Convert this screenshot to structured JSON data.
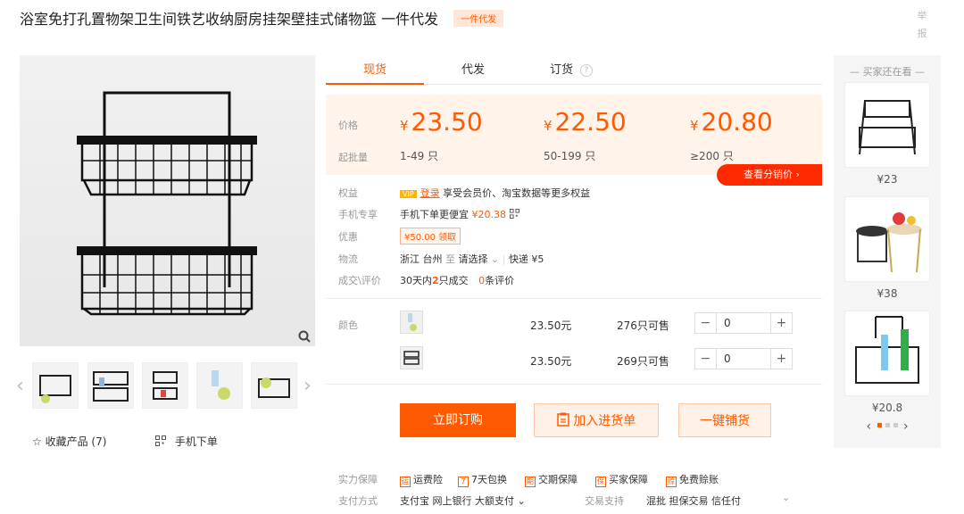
{
  "title": "浴室免打孔置物架卫生间铁艺收纳厨房挂架壁挂式储物篮 一件代发",
  "title_badge": "一件代发",
  "report": "举报",
  "tabs": [
    {
      "label": "现货"
    },
    {
      "label": "代发"
    },
    {
      "label": "订货"
    }
  ],
  "price_panel": {
    "price_label": "价格",
    "qty_label": "起批量",
    "currency": "¥",
    "tiers": [
      {
        "price": "23.50",
        "qty": "1-49 只"
      },
      {
        "price": "22.50",
        "qty": "50-199 只"
      },
      {
        "price": "20.80",
        "qty": "≥200 只"
      }
    ],
    "distrib_button": "查看分销价 ›"
  },
  "info": {
    "benefit_label": "权益",
    "vip_badge": "VIP",
    "login_link": "登录",
    "benefit_text": "享受会员价、淘宝数据等更多权益",
    "mobile_label": "手机专享",
    "mobile_text": "手机下单更便宜",
    "mobile_price": "¥20.38",
    "discount_label": "优惠",
    "coupon": "¥50.00 领取",
    "logistics_label": "物流",
    "origin": "浙江 台州",
    "to": "至",
    "dest": "请选择",
    "express": "快递 ¥5",
    "deals_label": "成交\\评价",
    "deals_prefix": "30天内",
    "deals_count": "2",
    "deals_suffix": "只成交",
    "review_count": "0",
    "review_suffix": "条评价"
  },
  "variants": {
    "label": "颜色",
    "items": [
      {
        "price": "23.50元",
        "stock": "276只可售",
        "qty": "0"
      },
      {
        "price": "23.50元",
        "stock": "269只可售",
        "qty": "0"
      }
    ]
  },
  "actions": {
    "buy": "立即订购",
    "add": "加入进货单",
    "distribute": "一键铺货"
  },
  "guarantee": {
    "label": "实力保障",
    "items": [
      "运费险",
      "7天包换",
      "交期保障",
      "买家保障",
      "免费赊账"
    ]
  },
  "payment": {
    "label": "支付方式",
    "methods": "支付宝  网上银行  大额支付 ⌄",
    "trade_label": "交易支持",
    "trade_items": "混批  担保交易  信任付"
  },
  "left": {
    "favorite": "☆  收藏产品 (7)",
    "mobile_order": "手机下单"
  },
  "side": {
    "header": "买家还在看",
    "items": [
      {
        "price": "¥23"
      },
      {
        "price": "¥38"
      },
      {
        "price": "¥20.8"
      }
    ]
  }
}
